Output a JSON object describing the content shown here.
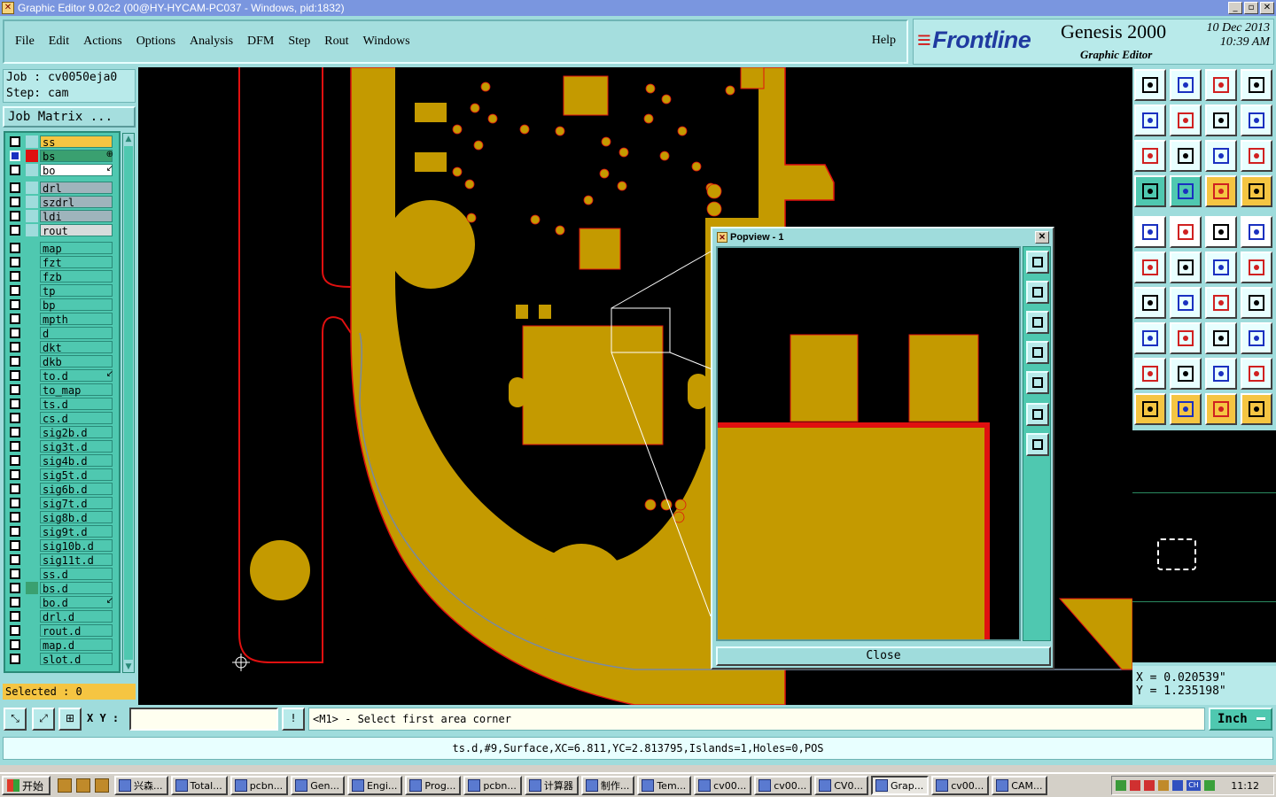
{
  "window": {
    "title": "Graphic Editor 9.02c2 (00@HY-HYCAM-PC037 - Windows, pid:1832)",
    "icon": "app-icon",
    "controls": [
      "_",
      "▫",
      "✕"
    ]
  },
  "menu": {
    "items": [
      "File",
      "Edit",
      "Actions",
      "Options",
      "Analysis",
      "DFM",
      "Step",
      "Rout",
      "Windows"
    ],
    "help": "Help"
  },
  "brand": {
    "logo": "Frontline",
    "product": "Genesis 2000",
    "subtitle": "Graphic Editor",
    "date": "10 Dec 2013",
    "time": "10:39 AM"
  },
  "job": {
    "job_line": "Job : cv0050eja0",
    "step_line": "Step: cam",
    "matrix_button": "Job Matrix ...",
    "selected": "Selected : 0"
  },
  "layers": [
    {
      "name": "ss",
      "bg": "#f5c542",
      "swatch": "#9fdcdc"
    },
    {
      "name": "bs",
      "bg": "#3aa070",
      "swatch": "#e01010",
      "mark": "⊕",
      "active": true
    },
    {
      "name": "bo",
      "bg": "#ffffff",
      "swatch": "#9fdcdc",
      "mark": "↙"
    },
    {
      "name": "drl",
      "bg": "#9fb4bc",
      "swatch": "#9fdcdc"
    },
    {
      "name": "szdrl",
      "bg": "#9fb4bc",
      "swatch": "#9fdcdc"
    },
    {
      "name": "ldi",
      "bg": "#9fb4bc",
      "swatch": "#9fdcdc"
    },
    {
      "name": "rout",
      "bg": "#d8dcdc",
      "swatch": "#9fdcdc"
    },
    {
      "name": "map",
      "bg": "#4fc8b0",
      "swatch": "#4fc8b0"
    },
    {
      "name": "fzt",
      "bg": "#4fc8b0",
      "swatch": "#4fc8b0"
    },
    {
      "name": "fzb",
      "bg": "#4fc8b0",
      "swatch": "#4fc8b0"
    },
    {
      "name": "tp",
      "bg": "#4fc8b0",
      "swatch": "#4fc8b0"
    },
    {
      "name": "bp",
      "bg": "#4fc8b0",
      "swatch": "#4fc8b0"
    },
    {
      "name": "mpth",
      "bg": "#4fc8b0",
      "swatch": "#4fc8b0"
    },
    {
      "name": "d",
      "bg": "#4fc8b0",
      "swatch": "#4fc8b0"
    },
    {
      "name": "dkt",
      "bg": "#4fc8b0",
      "swatch": "#4fc8b0"
    },
    {
      "name": "dkb",
      "bg": "#4fc8b0",
      "swatch": "#4fc8b0"
    },
    {
      "name": "to.d",
      "bg": "#4fc8b0",
      "swatch": "#4fc8b0",
      "mark": "↙"
    },
    {
      "name": "to_map",
      "bg": "#4fc8b0",
      "swatch": "#4fc8b0"
    },
    {
      "name": "ts.d",
      "bg": "#4fc8b0",
      "swatch": "#4fc8b0"
    },
    {
      "name": "cs.d",
      "bg": "#4fc8b0",
      "swatch": "#4fc8b0"
    },
    {
      "name": "sig2b.d",
      "bg": "#4fc8b0",
      "swatch": "#4fc8b0"
    },
    {
      "name": "sig3t.d",
      "bg": "#4fc8b0",
      "swatch": "#4fc8b0"
    },
    {
      "name": "sig4b.d",
      "bg": "#4fc8b0",
      "swatch": "#4fc8b0"
    },
    {
      "name": "sig5t.d",
      "bg": "#4fc8b0",
      "swatch": "#4fc8b0"
    },
    {
      "name": "sig6b.d",
      "bg": "#4fc8b0",
      "swatch": "#4fc8b0"
    },
    {
      "name": "sig7t.d",
      "bg": "#4fc8b0",
      "swatch": "#4fc8b0"
    },
    {
      "name": "sig8b.d",
      "bg": "#4fc8b0",
      "swatch": "#4fc8b0"
    },
    {
      "name": "sig9t.d",
      "bg": "#4fc8b0",
      "swatch": "#4fc8b0"
    },
    {
      "name": "sig10b.d",
      "bg": "#4fc8b0",
      "swatch": "#4fc8b0"
    },
    {
      "name": "sig11t.d",
      "bg": "#4fc8b0",
      "swatch": "#4fc8b0"
    },
    {
      "name": "ss.d",
      "bg": "#4fc8b0",
      "swatch": "#4fc8b0"
    },
    {
      "name": "bs.d",
      "bg": "#4fc8b0",
      "swatch": "#3aa070"
    },
    {
      "name": "bo.d",
      "bg": "#4fc8b0",
      "swatch": "#4fc8b0",
      "mark": "↙"
    },
    {
      "name": "drl.d",
      "bg": "#4fc8b0",
      "swatch": "#4fc8b0"
    },
    {
      "name": "rout.d",
      "bg": "#4fc8b0",
      "swatch": "#4fc8b0"
    },
    {
      "name": "map.d",
      "bg": "#4fc8b0",
      "swatch": "#4fc8b0"
    },
    {
      "name": "slot.d",
      "bg": "#4fc8b0",
      "swatch": "#4fc8b0"
    }
  ],
  "colors": {
    "copper": "#c49a00",
    "outline": "#e01010",
    "canvas": "#000000",
    "panel": "#9fdcdc",
    "accent_teal": "#4fc8b0"
  },
  "popview": {
    "title": "Popview - 1",
    "close_label": "Close"
  },
  "right_toolbar": {
    "buttons": [
      "snapshot-icon",
      "zoom-prev-icon",
      "home-icon",
      "zoom-window-icon",
      "pan-left-icon",
      "pan-right-icon",
      "undo-view-icon",
      "redraw-icon",
      "fit-screen-icon",
      "fit-profile-icon",
      "zoom-1to2-icon",
      "help-query-icon",
      "options-icon",
      "grid-icon",
      "net-highlight-icon",
      "net-select-icon",
      "add-pad-icon",
      "measure-icon",
      "ruler-icon",
      "fill-circle-icon",
      "connect-icon",
      "cross-icon",
      "move-icon",
      "copy-icon",
      "line-icon",
      "slash-icon",
      "arc-icon",
      "text-icon",
      "add-square-icon",
      "stretch-icon",
      "resize-icon",
      "feature-icon",
      "triangle-icon",
      "arrow-triangle-icon",
      "bold-triangle-icon",
      "alt-triangle-icon",
      "pointer-icon",
      "pointer-frame-icon",
      "pointer-bold-icon",
      "route-icon"
    ]
  },
  "coordinates": {
    "x": "X = 0.020539\"",
    "y": "Y = 1.235198\""
  },
  "command": {
    "xy_label": "X Y :",
    "xy_value": "",
    "prompt": "<M1> - Select first area corner",
    "unit": "Inch"
  },
  "status": "ts.d,#9,Surface,XC=6.811,YC=2.813795,Islands=1,Holes=0,POS",
  "taskbar": {
    "start": "开始",
    "tasks": [
      "兴森...",
      "Total...",
      "pcbn...",
      "Gen...",
      "Engi...",
      "Prog...",
      "pcbn...",
      "计算器",
      "制作...",
      "Tem...",
      "cv00...",
      "cv00...",
      "CV0...",
      "Grap...",
      "cv00...",
      "CAM..."
    ],
    "active_task": "Grap...",
    "tray_ime": "CH",
    "clock": "11:12"
  }
}
